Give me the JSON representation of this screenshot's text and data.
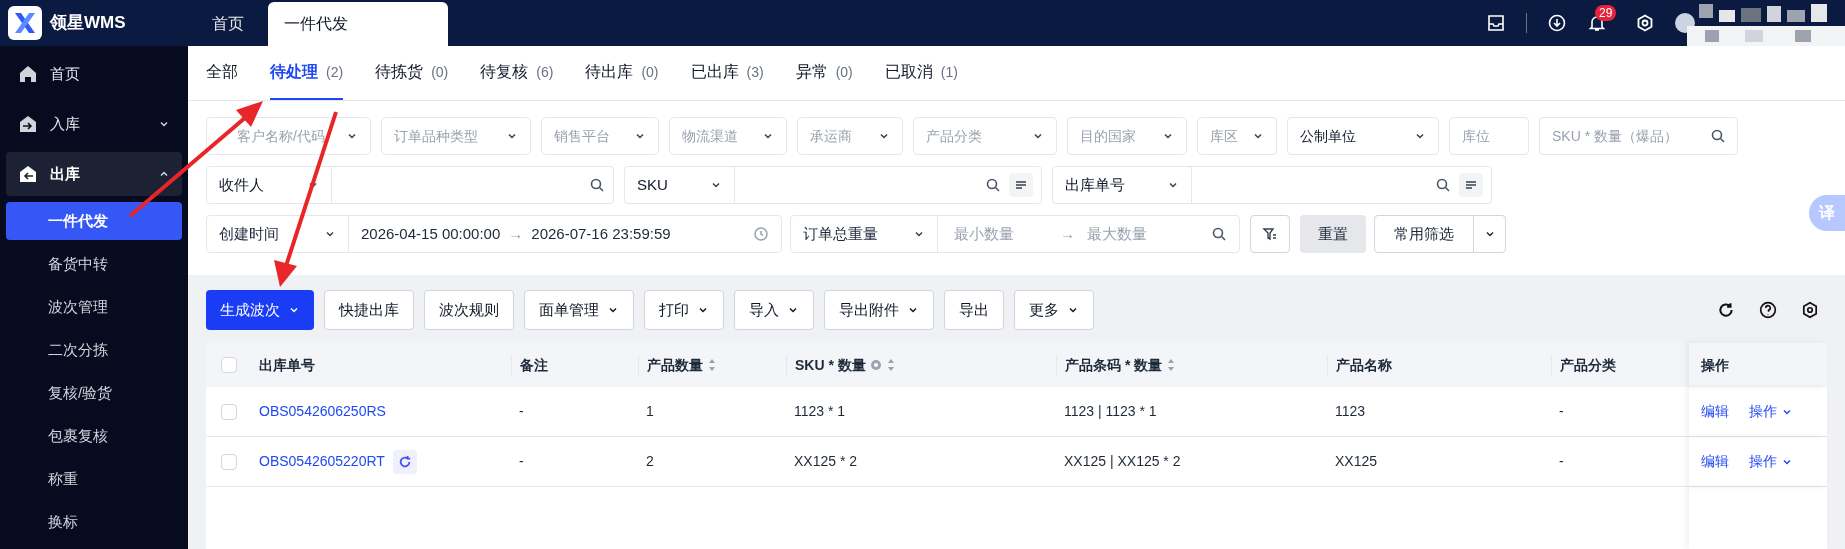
{
  "app": {
    "name": "领星WMS"
  },
  "top_tabs": [
    {
      "label": "首页",
      "selected": false
    },
    {
      "label": "一件代发",
      "selected": true
    }
  ],
  "header": {
    "notifications": "29"
  },
  "sidebar": {
    "items": [
      {
        "label": "首页",
        "expanded": false
      },
      {
        "label": "入库",
        "expanded": false
      },
      {
        "label": "出库",
        "expanded": true,
        "children": [
          {
            "label": "一件代发",
            "selected": true
          },
          {
            "label": "备货中转",
            "selected": false
          },
          {
            "label": "波次管理",
            "selected": false
          },
          {
            "label": "二次分拣",
            "selected": false
          },
          {
            "label": "复核/验货",
            "selected": false
          },
          {
            "label": "包裹复核",
            "selected": false
          },
          {
            "label": "称重",
            "selected": false
          },
          {
            "label": "换标",
            "selected": false
          }
        ]
      }
    ]
  },
  "status_tabs": [
    {
      "label": "全部",
      "selected": false
    },
    {
      "label": "待处理",
      "count": "(2)",
      "selected": true
    },
    {
      "label": "待拣货",
      "count": "(0)",
      "selected": false
    },
    {
      "label": "待复核",
      "count": "(6)",
      "selected": false
    },
    {
      "label": "待出库",
      "count": "(0)",
      "selected": false
    },
    {
      "label": "已出库",
      "count": "(3)",
      "selected": false
    },
    {
      "label": "异常",
      "count": "(0)",
      "selected": false
    },
    {
      "label": "已取消",
      "count": "(1)",
      "selected": false
    }
  ],
  "filters_row1": [
    {
      "kind": "select",
      "placeholder": "客户名称/代码"
    },
    {
      "kind": "select",
      "placeholder": "订单品种类型"
    },
    {
      "kind": "select",
      "placeholder": "销售平台"
    },
    {
      "kind": "select",
      "placeholder": "物流渠道"
    },
    {
      "kind": "select",
      "placeholder": "承运商"
    },
    {
      "kind": "select",
      "placeholder": "产品分类"
    },
    {
      "kind": "select",
      "placeholder": "目的国家"
    },
    {
      "kind": "select",
      "placeholder": "库区"
    },
    {
      "kind": "select",
      "value": "公制单位"
    },
    {
      "kind": "input",
      "placeholder": "库位"
    },
    {
      "kind": "search",
      "placeholder": "SKU * 数量（爆品）"
    }
  ],
  "filters_row2": [
    {
      "field": "收件人",
      "batch": false
    },
    {
      "field": "SKU",
      "batch": true
    },
    {
      "field": "出库单号",
      "batch": true
    }
  ],
  "date_filter": {
    "field": "创建时间",
    "start": "2026-04-15 00:00:00",
    "separator": "→",
    "end": "2026-07-16 23:59:59"
  },
  "weight_filter": {
    "field": "订单总重量",
    "min_placeholder": "最小数量",
    "separator": "→",
    "max_placeholder": "最大数量"
  },
  "filter_buttons": {
    "reset": "重置",
    "saved": "常用筛选"
  },
  "toolbar": [
    {
      "label": "生成波次",
      "primary": true,
      "dropdown": true
    },
    {
      "label": "快捷出库",
      "primary": false,
      "dropdown": false
    },
    {
      "label": "波次规则",
      "primary": false,
      "dropdown": false
    },
    {
      "label": "面单管理",
      "primary": false,
      "dropdown": true
    },
    {
      "label": "打印",
      "primary": false,
      "dropdown": true
    },
    {
      "label": "导入",
      "primary": false,
      "dropdown": true
    },
    {
      "label": "导出附件",
      "primary": false,
      "dropdown": true
    },
    {
      "label": "导出",
      "primary": false,
      "dropdown": false
    },
    {
      "label": "更多",
      "primary": false,
      "dropdown": true
    }
  ],
  "table": {
    "select_all_checked": false,
    "columns": [
      {
        "label": "出库单号",
        "sortable": false,
        "info": false
      },
      {
        "label": "备注",
        "sortable": false,
        "info": false
      },
      {
        "label": "产品数量",
        "sortable": true,
        "info": false
      },
      {
        "label": "SKU * 数量",
        "sortable": true,
        "info": true
      },
      {
        "label": "产品条码 * 数量",
        "sortable": true,
        "info": false
      },
      {
        "label": "产品名称",
        "sortable": false,
        "info": false
      },
      {
        "label": "产品分类",
        "sortable": false,
        "info": false
      }
    ],
    "actions_column": "操作",
    "rows": [
      {
        "checked": false,
        "cells": [
          "OBS0542606250RS",
          "-",
          "1",
          "1123 * 1",
          "1123 | 1123 * 1",
          "1123",
          "-"
        ],
        "refresh_badge": false,
        "actions": [
          "编辑",
          "操作"
        ]
      },
      {
        "checked": false,
        "cells": [
          "OBS0542605220RT",
          "-",
          "2",
          "XX125 * 2",
          "XX125 | XX125 * 2",
          "XX125",
          "-"
        ],
        "refresh_badge": true,
        "actions": [
          "编辑",
          "操作"
        ]
      }
    ]
  },
  "translate_button": "译"
}
